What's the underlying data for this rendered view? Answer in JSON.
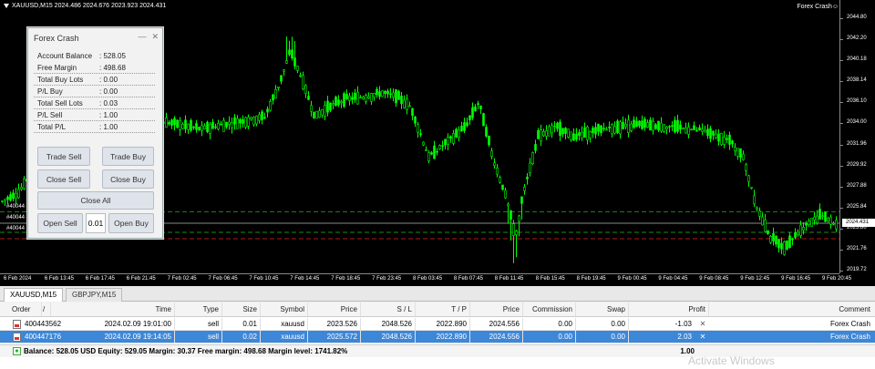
{
  "chart": {
    "header": "XAUUSD,M15  2024.486 2024.676 2023.923 2024.431",
    "ea_label": "Forex Crash☺",
    "current_price": "2024.431",
    "price_labels": [
      "2044.80",
      "2042.20",
      "2040.18",
      "2038.14",
      "2036.10",
      "2034.00",
      "2031.96",
      "2029.92",
      "2027.88",
      "2025.84",
      "2023.80",
      "2021.76",
      "2019.72"
    ],
    "time_labels": [
      "6 Feb 2024",
      "6 Feb 13:45",
      "6 Feb 17:45",
      "6 Feb 21:45",
      "7 Feb 02:45",
      "7 Feb 06:45",
      "7 Feb 10:45",
      "7 Feb 14:45",
      "7 Feb 18:45",
      "7 Feb 23:45",
      "8 Feb 03:45",
      "8 Feb 07:45",
      "8 Feb 11:45",
      "8 Feb 15:45",
      "8 Feb 19:45",
      "9 Feb 00:45",
      "9 Feb 04:45",
      "9 Feb 08:45",
      "9 Feb 12:45",
      "9 Feb 16:45",
      "9 Feb 20:45"
    ],
    "left_order_labels": [
      "#40044",
      "#40044",
      "#40044"
    ],
    "colors": {
      "bull": "#00ff00",
      "bear": "#00ff00",
      "background": "#000000",
      "entry_line": "#1a8a1a",
      "tp_line": "#b01818",
      "price_line": "#888888"
    }
  },
  "panel": {
    "title": "Forex Crash",
    "controls": {
      "minimize": "—",
      "close": "✕"
    },
    "stats": [
      {
        "label": "Account Balance",
        "value": ": 528.05"
      },
      {
        "label": "Free Margin",
        "value": ": 498.68"
      },
      {
        "label": "Total Buy Lots",
        "value": ": 0.00"
      },
      {
        "label": "P/L Buy",
        "value": ": 0.00"
      },
      {
        "label": "Total Sell Lots",
        "value": ": 0.03"
      },
      {
        "label": "P/L Sell",
        "value": ": 1.00"
      },
      {
        "label": "Total P/L",
        "value": ": 1.00"
      }
    ],
    "buttons": {
      "trade_sell": "Trade Sell",
      "trade_buy": "Trade Buy",
      "close_sell": "Close Sell",
      "close_buy": "Close Buy",
      "close_all": "Close All",
      "open_sell": "Open Sell",
      "open_buy": "Open Buy"
    },
    "lot_value": "0.01"
  },
  "symbol_tabs": [
    {
      "label": "XAUUSD,M15",
      "active": true
    },
    {
      "label": "GBPJPY,M15",
      "active": false
    }
  ],
  "trade_table": {
    "columns": [
      "Order",
      "/",
      "Time",
      "Type",
      "Size",
      "Symbol",
      "Price",
      "S / L",
      "T / P",
      "Price",
      "Commission",
      "Swap",
      "Profit",
      "Comment"
    ],
    "rows": [
      {
        "order": "400443562",
        "time": "2024.02.09 19:01:00",
        "type": "sell",
        "size": "0.01",
        "symbol": "xauusd",
        "price": "2023.526",
        "sl": "2048.526",
        "tp": "2022.890",
        "cur_price": "2024.556",
        "commission": "0.00",
        "swap": "0.00",
        "profit": "-1.03",
        "comment": "Forex Crash",
        "selected": false
      },
      {
        "order": "400447176",
        "time": "2024.02.09 19:14:05",
        "type": "sell",
        "size": "0.02",
        "symbol": "xauusd",
        "price": "2025.572",
        "sl": "2048.526",
        "tp": "2022.890",
        "cur_price": "2024.556",
        "commission": "0.00",
        "swap": "0.00",
        "profit": "2.03",
        "comment": "Forex Crash",
        "selected": true
      }
    ],
    "summary": "Balance: 528.05 USD  Equity: 529.05  Margin: 30.37  Free margin: 498.68  Margin level: 1741.82%",
    "summary_profit": "1.00"
  },
  "watermark": "Activate Windows"
}
